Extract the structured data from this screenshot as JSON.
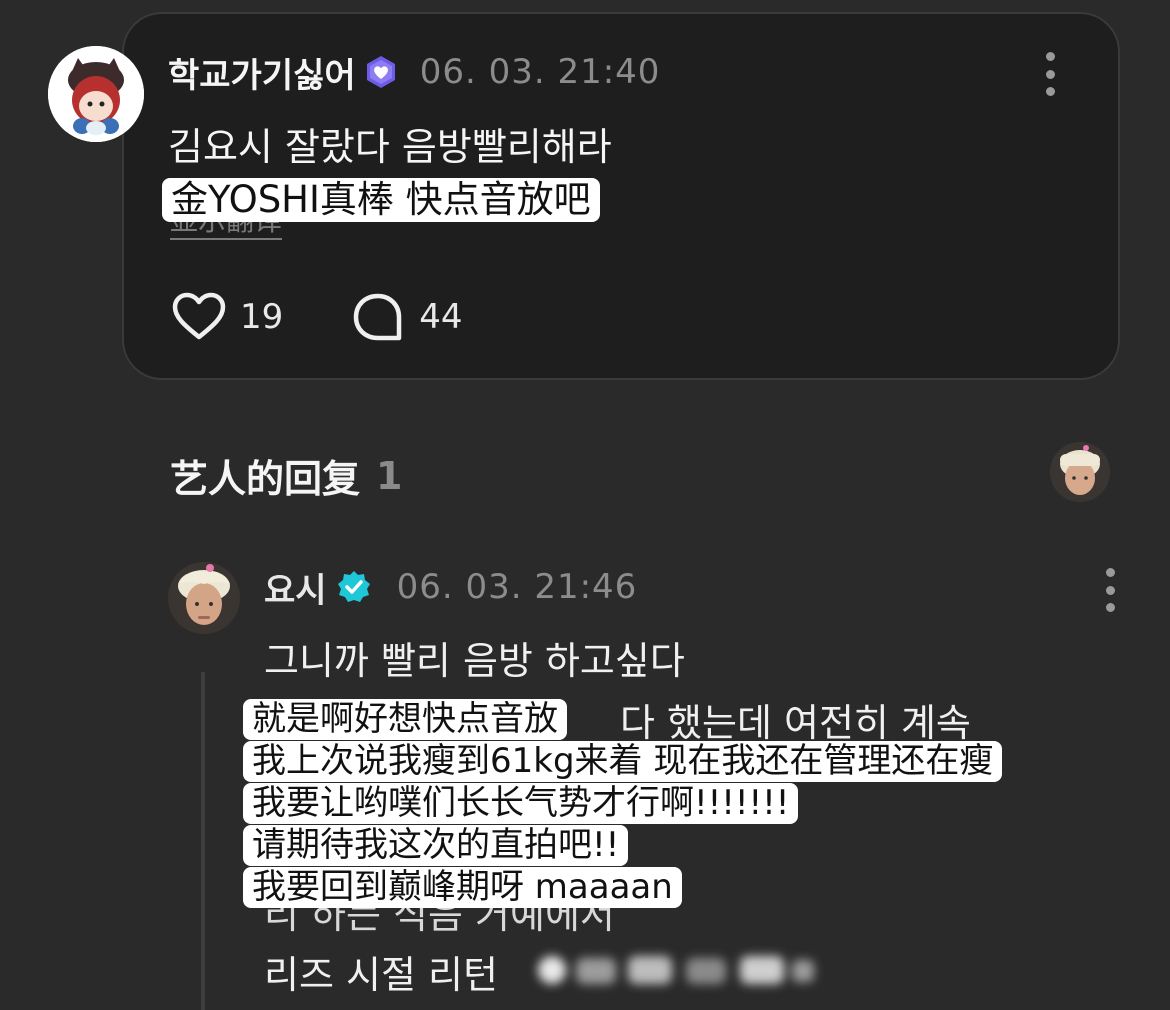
{
  "post": {
    "username": "학교가기싫어",
    "badge_icon": "purple-heart-badge-icon",
    "timestamp": "06. 03. 21:40",
    "text": "김요시 잘랐다 음방빨리해라",
    "translation": "金YOSHI真棒 快点音放吧",
    "translate_label": "显示翻译",
    "likes": "19",
    "comments": "44"
  },
  "artist_reply": {
    "title": "艺人的回复",
    "count": "1"
  },
  "reply": {
    "username": "요시",
    "badge_icon": "cyan-verified-check-icon",
    "timestamp": "06. 03. 21:46",
    "lines": [
      "그니까 빨리 음방 하고싶다",
      "다 했는데 여전히 계속",
      "리 하는 식음 거예에서",
      "리즈 시절 리턴"
    ],
    "translations": [
      "就是啊好想快点音放",
      "我上次说我瘦到61kg来着 现在我还在管理还在瘦",
      "我要让哟噗们长长气势才行啊!!!!!!!",
      "请期待我这次的直拍吧!!",
      "我要回到巅峰期呀 maaaan"
    ]
  },
  "colors": {
    "background": "#2a2a2b",
    "card": "#1e1e1f",
    "badge_purple": "#6c5ce7",
    "verified_cyan": "#1ec8d8"
  }
}
